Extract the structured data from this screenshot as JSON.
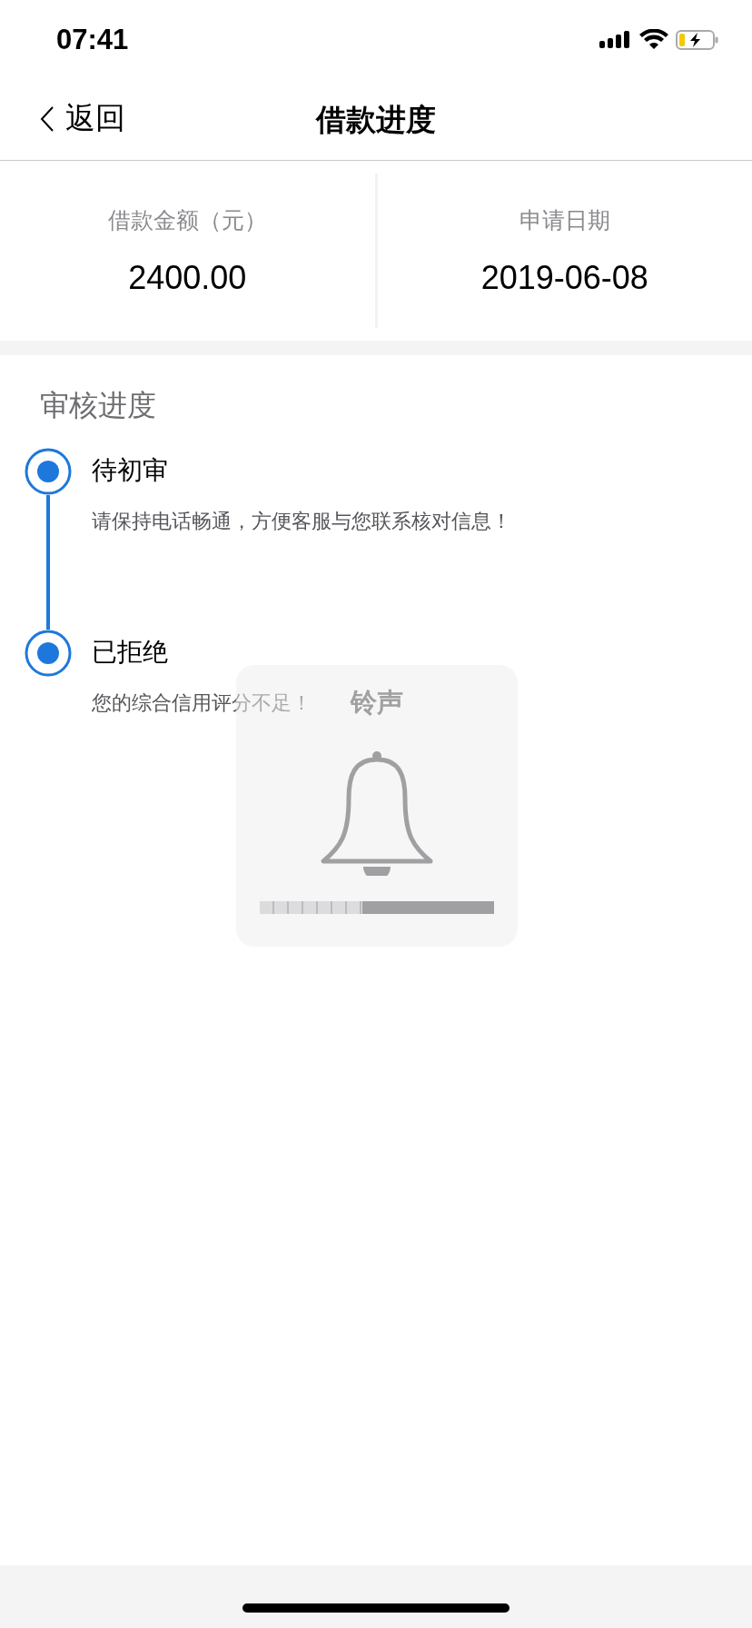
{
  "status_bar": {
    "time": "07:41"
  },
  "nav": {
    "back_label": "返回",
    "title": "借款进度"
  },
  "summary": [
    {
      "label": "借款金额（元）",
      "value": "2400.00"
    },
    {
      "label": "申请日期",
      "value": "2019-06-08"
    }
  ],
  "progress": {
    "title": "审核进度",
    "steps": [
      {
        "title": "待初审",
        "description": "请保持电话畅通，方便客服与您联系核对信息！"
      },
      {
        "title": "已拒绝",
        "description": "您的综合信用评分不足！"
      }
    ]
  },
  "ringer_overlay": {
    "title": "铃声",
    "level": 0.4375
  }
}
